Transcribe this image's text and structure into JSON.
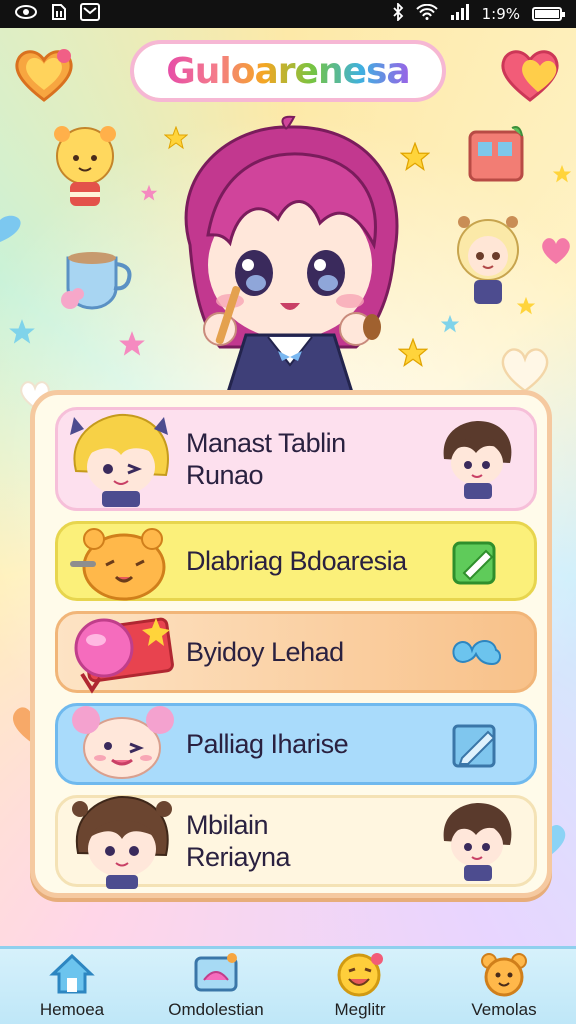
{
  "status_bar": {
    "time": "1:9%",
    "icons": [
      "eye-icon",
      "sim-icon",
      "message-icon",
      "bluetooth-icon",
      "wifi-icon",
      "signal-icon",
      "battery-icon"
    ]
  },
  "header": {
    "title": "Guloarenesa"
  },
  "hero": {
    "sign_text": ""
  },
  "menu": {
    "items": [
      {
        "label_line1": "Manast Tablin",
        "label_line2": "Runao",
        "right_icon": "chibi-icon"
      },
      {
        "label_line1": "Dlabriag Bdoaresia",
        "label_line2": "",
        "right_icon": "edit-icon"
      },
      {
        "label_line1": "Byidoy Lehad",
        "label_line2": "",
        "right_icon": "cloud-icon"
      },
      {
        "label_line1": "Palliag Iharise",
        "label_line2": "",
        "right_icon": "pencil-icon"
      },
      {
        "label_line1": "Mbilain",
        "label_line2": "Reriayna",
        "right_icon": "chibi-icon"
      }
    ]
  },
  "bottom_nav": {
    "items": [
      {
        "label": "Hemoea",
        "icon": "home-icon"
      },
      {
        "label": "Omdolestian",
        "icon": "tv-icon"
      },
      {
        "label": "Meglitr",
        "icon": "smile-icon"
      },
      {
        "label": "Vemolas",
        "icon": "bear-icon"
      }
    ]
  },
  "colors": {
    "accent_pink": "#e64ca8",
    "panel_bg": "#fffbea",
    "nav_bg": "#bfe7f8"
  }
}
